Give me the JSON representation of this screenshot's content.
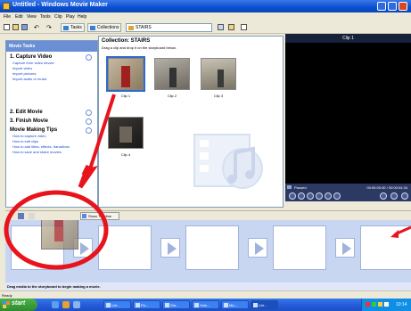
{
  "window": {
    "title": "Untitled - Windows Movie Maker"
  },
  "menu": [
    "File",
    "Edit",
    "View",
    "Tools",
    "Clip",
    "Play",
    "Help"
  ],
  "toolbar": {
    "tasks_label": "Tasks",
    "collections_label": "Collections",
    "collection_value": "STAIRS"
  },
  "task_pane": {
    "header": "Movie Tasks",
    "sections": [
      {
        "title": "1. Capture Video",
        "links": [
          "Capture from video device",
          "Import video",
          "Import pictures",
          "Import audio or music"
        ]
      },
      {
        "title": "2. Edit Movie",
        "links": []
      },
      {
        "title": "3. Finish Movie",
        "links": []
      },
      {
        "title": "Movie Making Tips",
        "links": [
          "How to capture video",
          "How to edit clips",
          "How to add titles, effects, transitions",
          "How to save and share movies"
        ]
      }
    ]
  },
  "collection": {
    "title": "Collection: STAIRS",
    "subtitle": "Drag a clip and drop it on the storyboard below.",
    "clips": [
      {
        "label": "Clip 1",
        "selected": true
      },
      {
        "label": "Clip 2",
        "selected": false
      },
      {
        "label": "Clip 3",
        "selected": false
      },
      {
        "label": "Clip 4",
        "selected": false
      }
    ]
  },
  "preview": {
    "title": "Clip 1",
    "status": "Paused",
    "time": "00:00:00.00 / 00:00:04.34"
  },
  "storyboard": {
    "show_timeline_label": "Show Timeline"
  },
  "hint": "Drag media to the storyboard to begin making a movie.",
  "status_bar": "Ready",
  "taskbar": {
    "start_label": "start",
    "tasks": [
      "Unt...",
      "Pic...",
      "Sta...",
      "Vide...",
      "Mic...",
      "Unt..."
    ],
    "clock": "10:14"
  },
  "colors": {
    "annotation": "#e8141c",
    "titlebar": "#0a4fd0",
    "taskbar": "#245ddb",
    "start": "#2e8b2e",
    "storyboard": "#c9d6f2"
  }
}
